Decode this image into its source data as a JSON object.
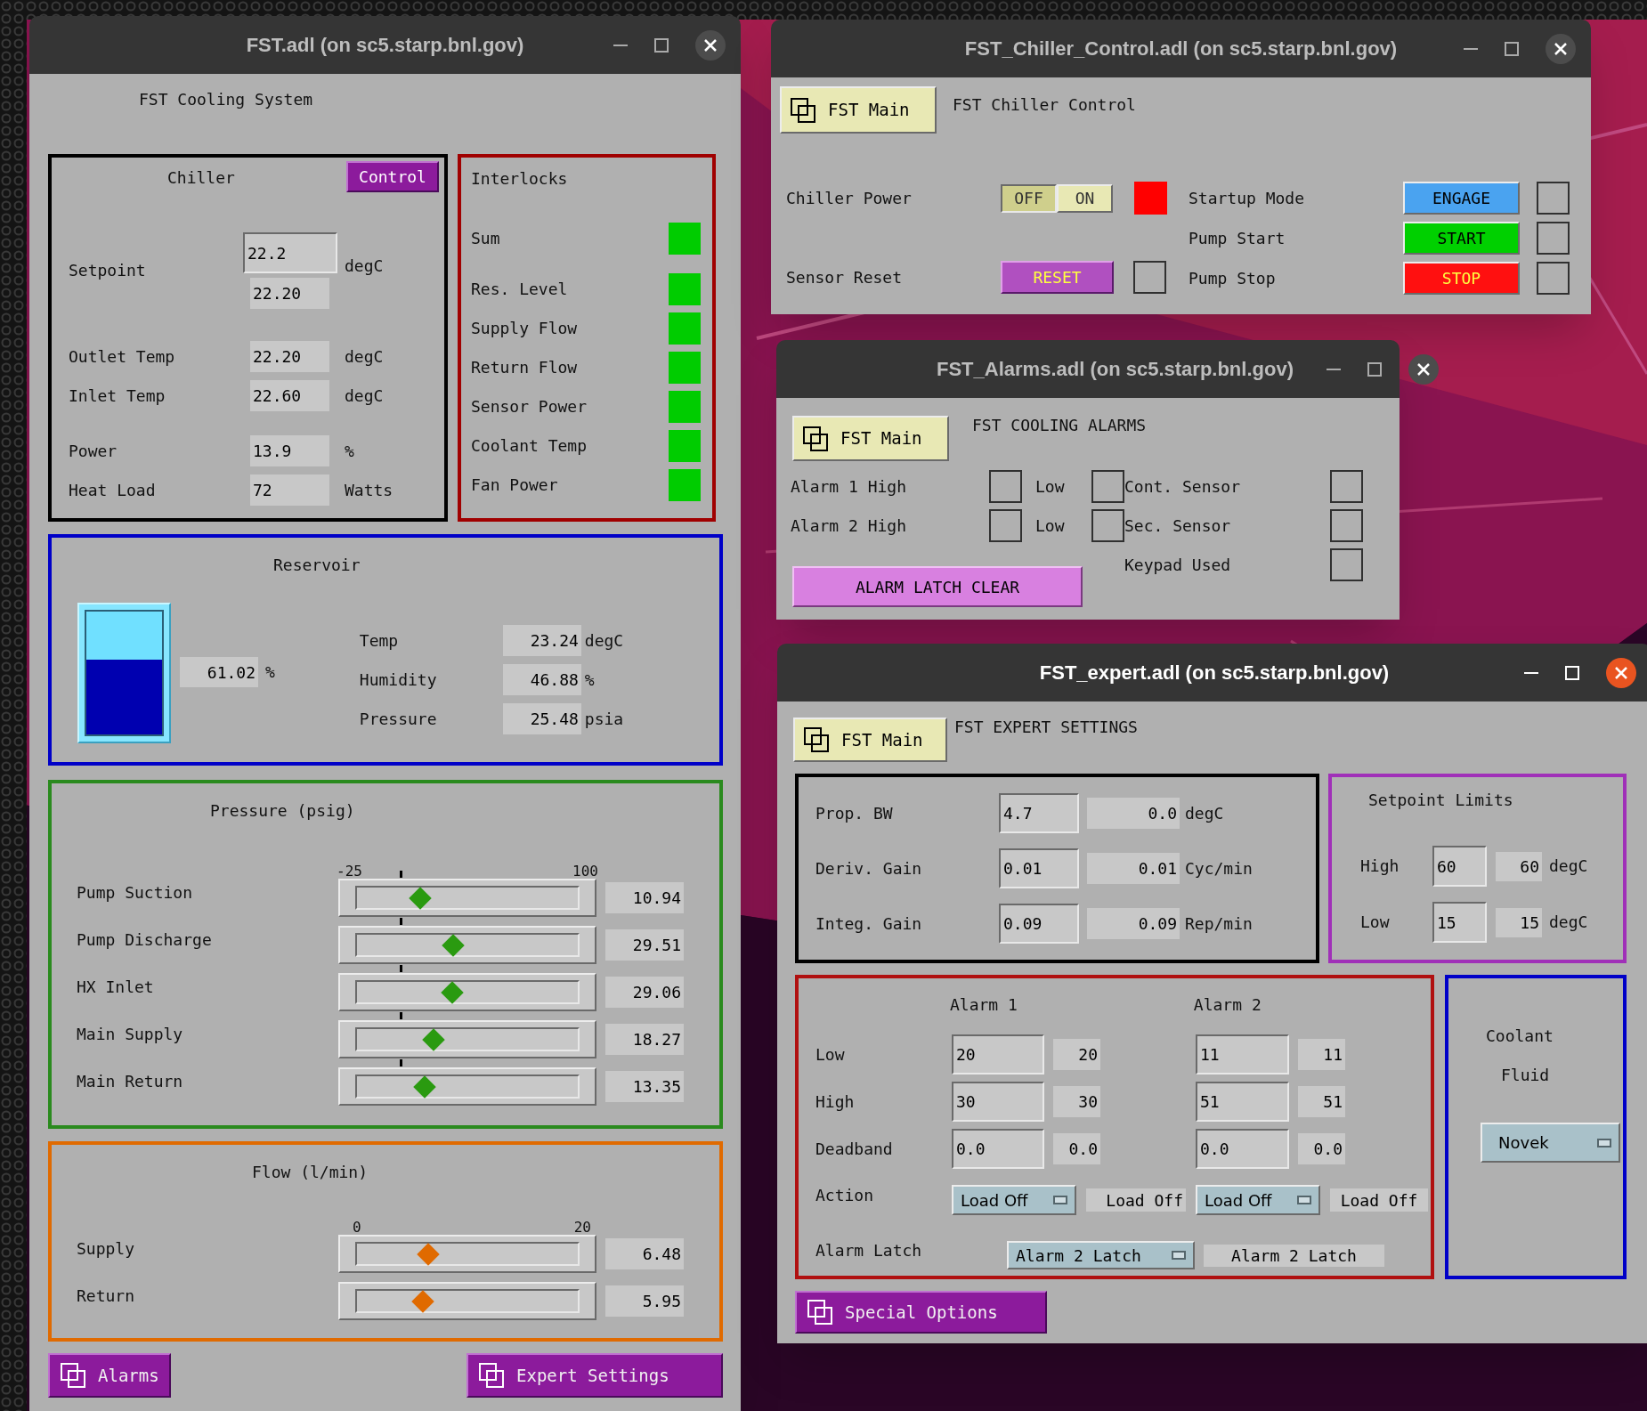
{
  "main_window": {
    "title": "FST.adl (on sc5.starp.bnl.gov)",
    "focused": false,
    "heading": "FST Cooling System",
    "chiller": {
      "title": "Chiller",
      "control_button": "Control",
      "setpoint": {
        "label": "Setpoint",
        "input": "22.2",
        "readback": "22.20",
        "unit": "degC"
      },
      "rows": [
        {
          "label": "Outlet Temp",
          "value": "22.20",
          "unit": "degC"
        },
        {
          "label": "Inlet Temp",
          "value": "22.60",
          "unit": "degC"
        },
        {
          "label": "Power",
          "value": "13.9",
          "unit": "%"
        },
        {
          "label": "Heat Load",
          "value": "72",
          "unit": "Watts"
        }
      ]
    },
    "interlocks": {
      "title": "Interlocks",
      "items": [
        {
          "label": "Sum",
          "lit": true
        },
        {
          "label": "Res. Level",
          "lit": true
        },
        {
          "label": "Supply Flow",
          "lit": true
        },
        {
          "label": "Return Flow",
          "lit": true
        },
        {
          "label": "Sensor Power",
          "lit": true
        },
        {
          "label": "Coolant Temp",
          "lit": true
        },
        {
          "label": "Fan Power",
          "lit": true
        }
      ]
    },
    "reservoir": {
      "title": "Reservoir",
      "level": 0.6102,
      "reading": "61.02",
      "unit": "%",
      "rows": [
        {
          "label": "Temp",
          "value": "23.24",
          "unit": "degC"
        },
        {
          "label": "Humidity",
          "value": "46.88",
          "unit": "%"
        },
        {
          "label": "Pressure",
          "value": "25.48",
          "unit": "psia"
        }
      ]
    },
    "pressure": {
      "title": "Pressure (psig)",
      "scale_min": "-25",
      "scale_max": "100",
      "gauges": [
        {
          "label": "Pump Suction",
          "level": 0.2875,
          "reading": "10.94"
        },
        {
          "label": "Pump Discharge",
          "level": 0.436,
          "reading": "29.51"
        },
        {
          "label": "HX Inlet",
          "level": 0.4325,
          "reading": "29.06"
        },
        {
          "label": "Main Supply",
          "level": 0.346,
          "reading": "18.27"
        },
        {
          "label": "Main Return",
          "level": 0.307,
          "reading": "13.35"
        }
      ]
    },
    "flow": {
      "title": "Flow (l/min)",
      "scale_min": "0",
      "scale_max": "20",
      "gauges": [
        {
          "label": "Supply",
          "level": 0.324,
          "reading": "6.48"
        },
        {
          "label": "Return",
          "level": 0.2975,
          "reading": "5.95"
        }
      ]
    },
    "buttons": [
      {
        "label": "Alarms"
      },
      {
        "label": "Expert Settings"
      }
    ]
  },
  "chiller_window": {
    "title": "FST_Chiller_Control.adl (on sc5.starp.bnl.gov)",
    "focused": false,
    "nav_button": "FST Main",
    "heading": "FST Chiller Control",
    "power": {
      "label": "Chiller Power",
      "options": [
        {
          "label": "OFF",
          "selected": true
        },
        {
          "label": "ON",
          "selected": false
        }
      ],
      "lit": true
    },
    "reset": {
      "label": "Sensor Reset",
      "button": "RESET",
      "lit": false
    },
    "commands": [
      {
        "label": "Startup Mode",
        "button": "ENGAGE",
        "kind": "engage",
        "lit": false
      },
      {
        "label": "Pump Start",
        "button": "START",
        "kind": "start",
        "lit": false
      },
      {
        "label": "Pump Stop",
        "button": "STOP",
        "kind": "stop",
        "lit": false
      }
    ]
  },
  "alarms_window": {
    "title": "FST_Alarms.adl (on sc5.starp.bnl.gov)",
    "focused": false,
    "nav_button": "FST Main",
    "heading": "FST COOLING ALARMS",
    "alarms": [
      {
        "label": "Alarm 1 High",
        "high_lit": false,
        "low_label": "Low",
        "low_lit": false
      },
      {
        "label": "Alarm 2 High",
        "high_lit": false,
        "low_label": "Low",
        "low_lit": false
      }
    ],
    "sensors": [
      {
        "label": "Cont. Sensor",
        "lit": false
      },
      {
        "label": "Sec. Sensor",
        "lit": false
      },
      {
        "label": "Keypad Used",
        "lit": false
      }
    ],
    "clear_button": "ALARM LATCH CLEAR"
  },
  "expert_window": {
    "title": "FST_expert.adl (on sc5.starp.bnl.gov)",
    "focused": true,
    "nav_button": "FST Main",
    "heading": "FST EXPERT SETTINGS",
    "pid": [
      {
        "label": "Prop. BW",
        "input": "4.7",
        "readback": "0.0",
        "unit": "degC"
      },
      {
        "label": "Deriv. Gain",
        "input": "0.01",
        "readback": "0.01",
        "unit": "Cyc/min"
      },
      {
        "label": "Integ. Gain",
        "input": "0.09",
        "readback": "0.09",
        "unit": "Rep/min"
      }
    ],
    "setpoint_limits": {
      "title": "Setpoint Limits",
      "rows": [
        {
          "label": "High",
          "input": "60",
          "readback": "60",
          "unit": "degC"
        },
        {
          "label": "Low",
          "input": "15",
          "readback": "15",
          "unit": "degC"
        }
      ]
    },
    "alarm_settings": {
      "columns": [
        "Alarm 1",
        "Alarm 2"
      ],
      "rows": [
        {
          "label": "Low",
          "values": [
            {
              "input": "20",
              "readback": "20"
            },
            {
              "input": "11",
              "readback": "11"
            }
          ]
        },
        {
          "label": "High",
          "values": [
            {
              "input": "30",
              "readback": "30"
            },
            {
              "input": "51",
              "readback": "51"
            }
          ]
        },
        {
          "label": "Deadband",
          "values": [
            {
              "input": "0.0",
              "readback": "0.0"
            },
            {
              "input": "0.0",
              "readback": "0.0"
            }
          ]
        }
      ],
      "action": {
        "label": "Action",
        "values": [
          {
            "menu": "Load Off",
            "readback": "Load Off"
          },
          {
            "menu": "Load Off",
            "readback": "Load Off"
          }
        ]
      },
      "latch": {
        "label": "Alarm Latch",
        "menu": "Alarm 2 Latch",
        "readback": "Alarm 2 Latch"
      }
    },
    "coolant": {
      "label_1": "Coolant",
      "label_2": "Fluid",
      "menu": "Novek"
    },
    "special_button": "Special Options"
  }
}
